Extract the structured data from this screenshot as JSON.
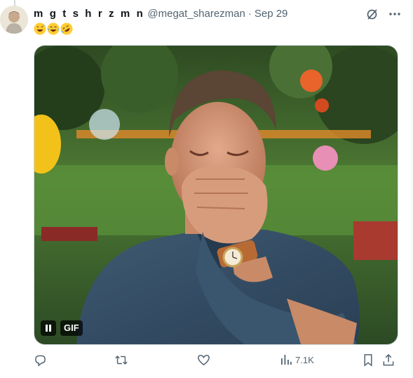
{
  "tweet": {
    "display_name": "m g t s h r z m n",
    "handle": "@megat_sharezman",
    "separator": "·",
    "date": "Sep 29",
    "text_emojis": [
      "sweat-smile",
      "joy",
      "rofl"
    ]
  },
  "media": {
    "type": "gif",
    "badge": "GIF",
    "description_icon": "laughing-man-gif",
    "playing": true
  },
  "actions": {
    "reply_icon": "reply-icon",
    "retweet_icon": "retweet-icon",
    "like_icon": "like-icon",
    "views_count": "7.1K",
    "bookmark_icon": "bookmark-icon",
    "share_icon": "share-icon"
  },
  "top_icons": [
    "grok-icon",
    "more-icon"
  ],
  "colors": {
    "text_primary": "#0f1419",
    "text_secondary": "#536471",
    "border": "#cfd9de"
  }
}
